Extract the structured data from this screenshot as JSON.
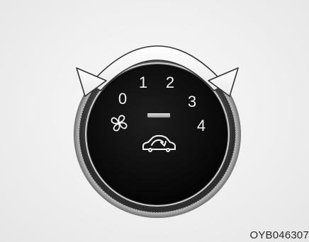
{
  "dial": {
    "speed_labels": [
      "0",
      "1",
      "2",
      "3",
      "4"
    ],
    "icons": {
      "fan": "fan-icon",
      "recirculation": "car-recirculation-icon",
      "rotation_arrow": "double-headed-arc-arrow-icon"
    }
  },
  "caption": {
    "code": "OYB046307"
  },
  "colors": {
    "background": "#efefef",
    "knob_face": "#111111",
    "knob_ring": "#5a5a5a",
    "marker": "#bdbdbd",
    "arrow_outline": "#333333"
  }
}
